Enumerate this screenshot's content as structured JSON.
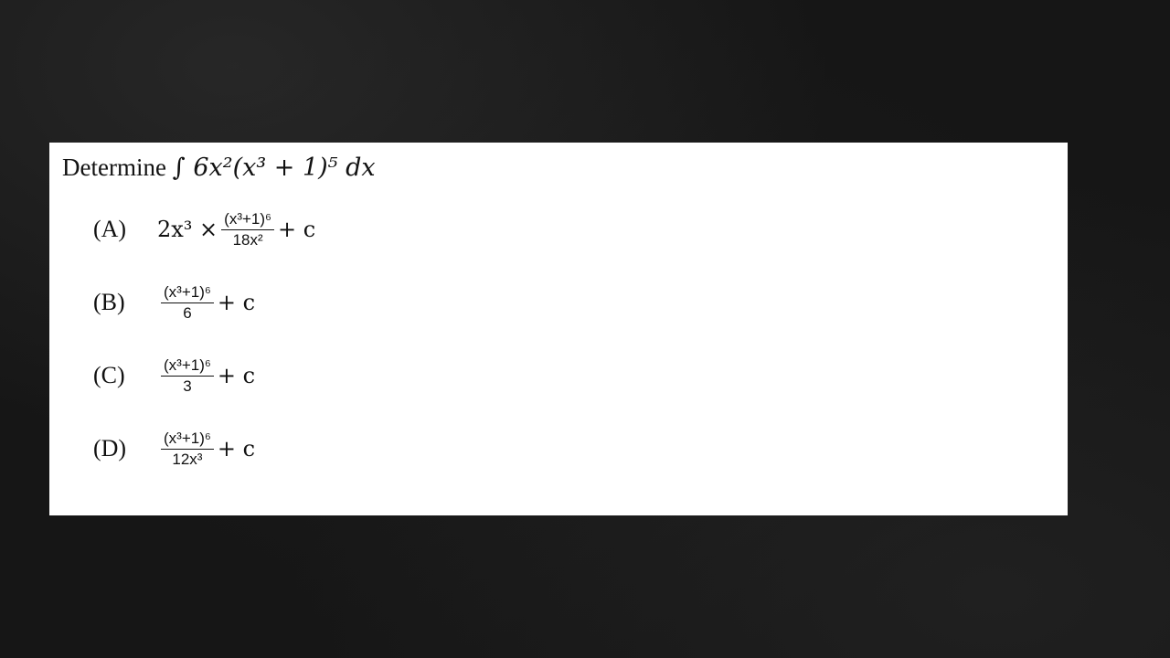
{
  "question": {
    "prefix": "Determine",
    "expression": "∫ 6x²(x³ + 1)⁵ dx"
  },
  "options": [
    {
      "label": "(A)",
      "pre": "2x³ ×",
      "numerator": "(x³+1)⁶",
      "denominator": "18x²",
      "post": "+ c"
    },
    {
      "label": "(B)",
      "pre": "",
      "numerator": "(x³+1)⁶",
      "denominator": "6",
      "post": "+ c"
    },
    {
      "label": "(C)",
      "pre": "",
      "numerator": "(x³+1)⁶",
      "denominator": "3",
      "post": "+ c"
    },
    {
      "label": "(D)",
      "pre": "",
      "numerator": "(x³+1)⁶",
      "denominator": "12x³",
      "post": "+ c"
    }
  ],
  "colors": {
    "background": "#161616",
    "panel": "#ffffff",
    "text": "#111111"
  }
}
